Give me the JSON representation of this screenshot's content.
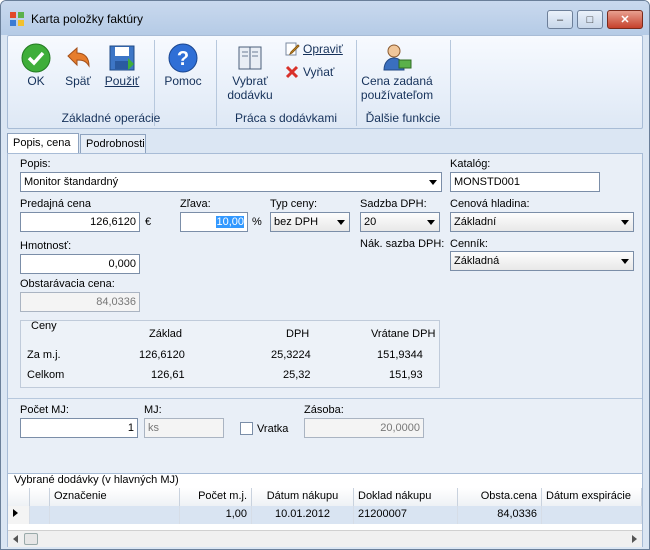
{
  "window": {
    "title": "Karta položky faktúry",
    "min": "–",
    "max": "□",
    "close": "✕"
  },
  "ribbon": {
    "ok": "OK",
    "spat": "Späť",
    "pouzit": "Použiť",
    "pomoc": "Pomoc",
    "vybrat1": "Vybrať",
    "vybrat2": "dodávku",
    "opravit": "Opraviť",
    "vyniat": "Vyňať",
    "cena1": "Cena zadaná",
    "cena2": "používateľom",
    "g1": "Základné operácie",
    "g2": "Práca s dodávkami",
    "g3": "Ďalšie funkcie"
  },
  "tabs": {
    "popis": "Popis, cena",
    "podrobnosti": "Podrobnosti"
  },
  "form": {
    "popis_label": "Popis:",
    "popis_value": "Monitor štandardný",
    "katalog_label": "Katalóg:",
    "katalog_value": "MONSTD001",
    "predajna_label": "Predajná cena",
    "predajna_value": "126,6120",
    "currency": "€",
    "zlava_label": "Zľava:",
    "zlava_value": "10,00",
    "pct": "%",
    "typ_label": "Typ ceny:",
    "typ_value": "bez DPH",
    "sadzba_label": "Sadzba DPH:",
    "sadzba_value": "20",
    "nak_sadzba_label": "Nák. sazba DPH:",
    "hladina_label": "Cenová hladina:",
    "hladina_value": "Základní",
    "cennik_label": "Cenník:",
    "cennik_value": "Základná",
    "hmotnost_label": "Hmotnosť:",
    "hmotnost_value": "0,000",
    "obstar_label": "Obstarávacia cena:",
    "obstar_value": "84,0336",
    "pocet_label": "Počet MJ:",
    "pocet_value": "1",
    "mj_label": "MJ:",
    "mj_value": "ks",
    "vratka_label": "Vratka",
    "zasoba_label": "Zásoba:",
    "zasoba_value": "20,0000"
  },
  "ceny": {
    "title": "Ceny",
    "h_zaklad": "Základ",
    "h_dph": "DPH",
    "h_vratane": "Vrátane DPH",
    "r1_label": "Za m.j.",
    "r1_zaklad": "126,6120",
    "r1_dph": "25,3224",
    "r1_vratane": "151,9344",
    "r2_label": "Celkom",
    "r2_zaklad": "126,61",
    "r2_dph": "25,32",
    "r2_vratane": "151,93"
  },
  "grid": {
    "title": "Vybrané dodávky (v hlavných MJ)",
    "cols": [
      "Označenie",
      "Počet m.j.",
      "Dátum nákupu",
      "Doklad nákupu",
      "Obsta.cena",
      "Dátum exspirácie"
    ],
    "row": [
      "",
      "1,00",
      "10.01.2012",
      "21200007",
      "84,0336",
      ""
    ]
  }
}
